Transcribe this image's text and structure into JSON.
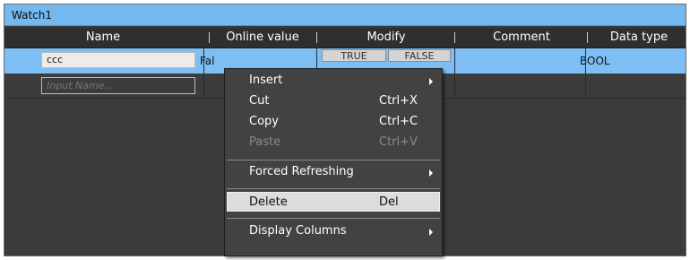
{
  "window": {
    "title": "Watch1"
  },
  "columns": {
    "name": "Name",
    "online_value": "Online value",
    "modify": "Modify",
    "comment": "Comment",
    "data_type": "Data type"
  },
  "rows": [
    {
      "name": "ccc",
      "online_value": "Fal",
      "modify_true": "TRUE",
      "modify_false": "FALSE",
      "comment": "",
      "data_type": "BOOL"
    }
  ],
  "new_row": {
    "placeholder": "Input Name..."
  },
  "context_menu": {
    "items": [
      {
        "label": "Insert",
        "shortcut": "",
        "submenu": true,
        "disabled": false
      },
      {
        "label": "Cut",
        "shortcut": "Ctrl+X",
        "submenu": false,
        "disabled": false
      },
      {
        "label": "Copy",
        "shortcut": "Ctrl+C",
        "submenu": false,
        "disabled": false
      },
      {
        "label": "Paste",
        "shortcut": "Ctrl+V",
        "submenu": false,
        "disabled": true
      },
      {
        "label": "Forced Refreshing",
        "shortcut": "",
        "submenu": true,
        "disabled": false
      },
      {
        "label": "Delete",
        "shortcut": "Del",
        "submenu": false,
        "disabled": false,
        "highlighted": true
      },
      {
        "label": "Display Columns",
        "shortcut": "",
        "submenu": true,
        "disabled": false
      }
    ]
  },
  "colors": {
    "title_bar": "#73b8ee",
    "selected_row": "#7dbff4",
    "grid_background": "#3b3b3b",
    "menu_background": "#424242",
    "menu_highlight": "#dcdcdc"
  }
}
